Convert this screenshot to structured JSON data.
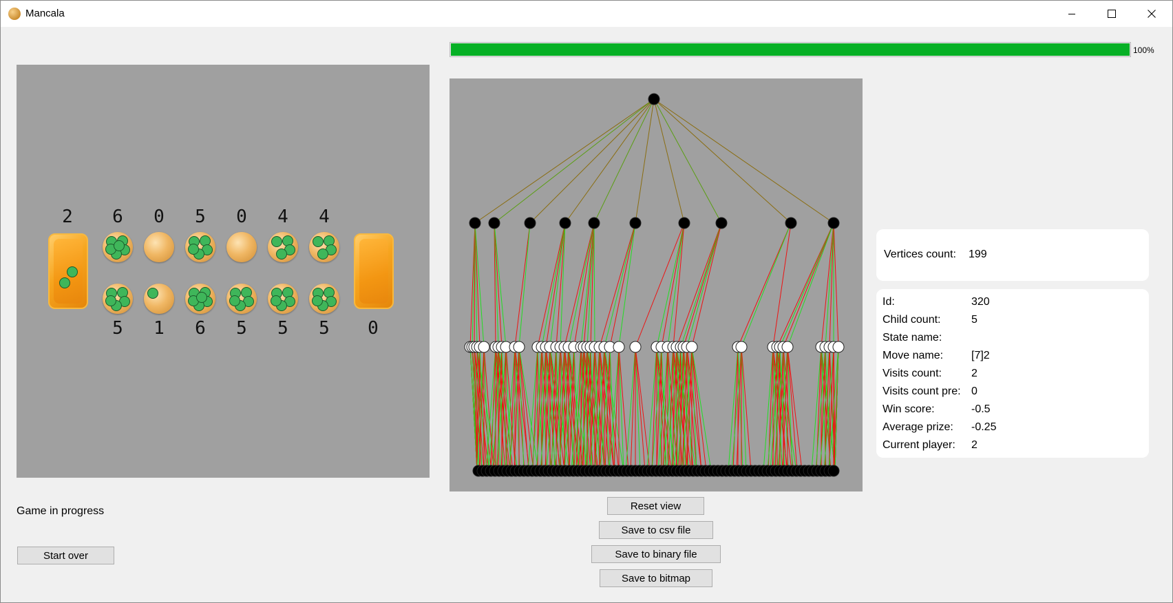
{
  "window": {
    "title": "Mancala",
    "progress_percent": 100,
    "progress_label": "100%"
  },
  "colors": {
    "progress": "#06b025",
    "board_bg": "#a0a0a0",
    "stone": "#3fb65a",
    "store": "#f39612",
    "edge_green": "#22dd22",
    "edge_red": "#ee1111",
    "edge_olive": "#8a7a10"
  },
  "board": {
    "top_counts": [
      "2",
      "6",
      "0",
      "5",
      "0",
      "4",
      "4"
    ],
    "bottom_counts": [
      "5",
      "1",
      "6",
      "5",
      "5",
      "5",
      "0"
    ],
    "top_pit_stones": [
      6,
      0,
      5,
      0,
      4,
      4
    ],
    "bottom_pit_stones": [
      5,
      1,
      6,
      5,
      5,
      5
    ],
    "left_store_stones": 2,
    "right_store_stones": 0
  },
  "status": "Game in progress",
  "buttons": {
    "start_over": "Start over",
    "reset_view": "Reset view",
    "save_csv": "Save to csv file",
    "save_binary": "Save to binary file",
    "save_bitmap": "Save to bitmap"
  },
  "vertices": {
    "label": "Vertices count:",
    "value": "199"
  },
  "node_info": {
    "id_label": "Id:",
    "id": "320",
    "child_count_label": "Child count:",
    "child_count": "5",
    "state_name_label": "State name:",
    "state_name": "",
    "move_name_label": "Move name:",
    "move_name": "[7]2",
    "visits_count_label": "Visits count:",
    "visits_count": "2",
    "visits_count_pre_label": "Visits count pre:",
    "visits_count_pre": "0",
    "win_score_label": "Win score:",
    "win_score": "-0.5",
    "average_prize_label": "Average prize:",
    "average_prize": "-0.25",
    "current_player_label": "Current player:",
    "current_player": "2"
  },
  "icons": {
    "app": "mancala-stone-icon",
    "minimize": "minimize-icon",
    "maximize": "maximize-icon",
    "close": "close-icon"
  }
}
